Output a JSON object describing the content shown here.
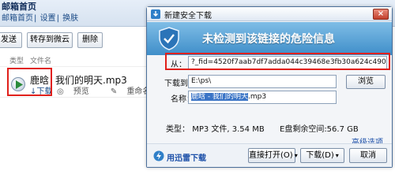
{
  "background": {
    "header_title": "邮箱首页",
    "header_links": [
      "邮箱首页",
      "设置",
      "换肤"
    ],
    "toolbar": {
      "send_label": "发送",
      "forward_label": "转存到微云",
      "delete_label": "删除"
    },
    "columns": {
      "type_label": "类型",
      "filename_label": "文件名"
    },
    "attachment": {
      "sender": "鹿晗",
      "download_label": "下载",
      "subject": "我们的明天.mp3",
      "actions": [
        "预览",
        "重命名",
        "删除"
      ]
    }
  },
  "dialog": {
    "title": "新建安全下载",
    "close_label": "×",
    "banner_text": "未检测到该链接的危险信息",
    "from_label": "从：",
    "from_value": "?_fid=4520f7aab7df7adda044c39468e3fb30a624c4900&uffs=3713567",
    "download_to_label": "下载到：",
    "download_to_value": "E:\\ps\\",
    "browse_label": "浏览",
    "name_label": "名称：",
    "name_highlight": "鹿晗 - 我们的明天",
    "name_ext": ".mp3",
    "file_type_label": "类型：",
    "file_type_value": "MP3 文件, 3.54 MB",
    "free_space_text": "E盘剩余空间:56.7 GB",
    "advanced_label": "高级选项",
    "brand_label": "用迅雷下载",
    "open_label": "直接打开(O)",
    "download_label": "下载(D)",
    "cancel_label": "取消"
  }
}
